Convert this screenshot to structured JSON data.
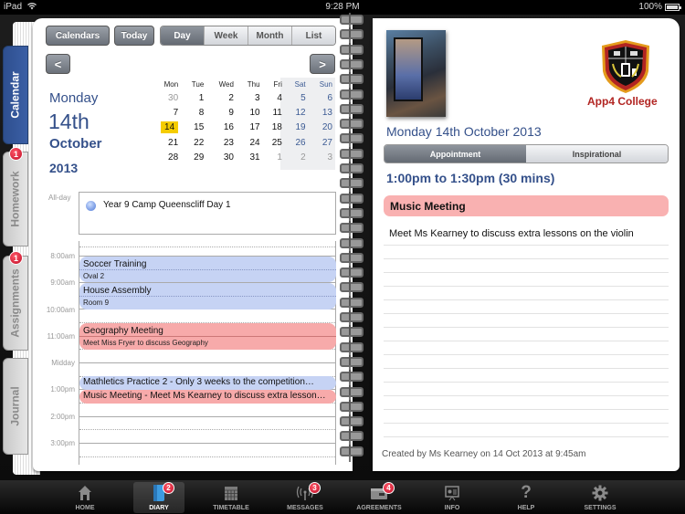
{
  "status_bar": {
    "device": "iPad",
    "time": "9:28 PM",
    "battery": "100%",
    "battery_level": 1.0
  },
  "side_tabs": [
    {
      "label": "Calendar",
      "active": true,
      "badge": null
    },
    {
      "label": "Homework",
      "active": false,
      "badge": "1"
    },
    {
      "label": "Assignments",
      "active": false,
      "badge": "1"
    },
    {
      "label": "Journal",
      "active": false,
      "badge": null
    }
  ],
  "toolbar": {
    "calendars_label": "Calendars",
    "today_label": "Today",
    "views": [
      "Day",
      "Week",
      "Month",
      "List"
    ],
    "active_view": "Day",
    "prev_label": "<",
    "next_label": ">"
  },
  "date_header": {
    "day_name": "Monday",
    "day": "14th",
    "month": "October",
    "year": "2013"
  },
  "mini_calendar": {
    "weekdays": [
      "Mon",
      "Tue",
      "Wed",
      "Thu",
      "Fri",
      "Sat",
      "Sun"
    ],
    "weeks": [
      [
        "30",
        "1",
        "2",
        "3",
        "4",
        "5",
        "6"
      ],
      [
        "7",
        "8",
        "9",
        "10",
        "11",
        "12",
        "13"
      ],
      [
        "14",
        "15",
        "16",
        "17",
        "18",
        "19",
        "20"
      ],
      [
        "21",
        "22",
        "23",
        "24",
        "25",
        "26",
        "27"
      ],
      [
        "28",
        "29",
        "30",
        "31",
        "1",
        "2",
        "3"
      ]
    ],
    "selected": "14"
  },
  "all_day": {
    "label": "All-day",
    "event": "Year 9 Camp Queenscliff Day 1",
    "event_color": "#4b76d6"
  },
  "time_labels": [
    "8:00am",
    "9:00am",
    "10:00am",
    "11:00am",
    "Midday",
    "1:00pm",
    "2:00pm",
    "3:00pm"
  ],
  "events": [
    {
      "title": "Soccer Training",
      "subtitle": "Oval 2",
      "color": "blue"
    },
    {
      "title": "House Assembly",
      "subtitle": "Room 9",
      "color": "blue"
    },
    {
      "title": "Geography Meeting",
      "subtitle": "Meet Miss Fryer to discuss Geography",
      "color": "red"
    },
    {
      "title": "Mathletics Practice 2 - Only 3 weeks to the competition…",
      "subtitle": null,
      "color": "blue"
    },
    {
      "title": "Music Meeting - Meet Ms Kearney to discuss extra lesson…",
      "subtitle": null,
      "color": "red"
    }
  ],
  "detail": {
    "logo_text": "App4 College",
    "date": "Monday 14th October 2013",
    "tabs": [
      "Appointment",
      "Inspirational"
    ],
    "active_tab": "Appointment",
    "time_range": "1:00pm to 1:30pm (30 mins)",
    "title": "Music Meeting",
    "description": "Meet Ms Kearney to discuss extra lessons on the violin",
    "created": "Created by Ms Kearney on 14 Oct 2013 at 9:45am"
  },
  "colors": {
    "accent_blue": "#34508a",
    "event_blue": "#c6d3f4",
    "event_red": "#f7aaaa",
    "today_highlight": "#f5cc00",
    "logo_red": "#b22522"
  },
  "tab_bar": [
    {
      "label": "HOME",
      "icon": "home-icon",
      "badge": null,
      "active": false
    },
    {
      "label": "DIARY",
      "icon": "diary-icon",
      "badge": "2",
      "active": true
    },
    {
      "label": "TIMETABLE",
      "icon": "timetable-icon",
      "badge": null,
      "active": false
    },
    {
      "label": "MESSAGES",
      "icon": "messages-icon",
      "badge": "3",
      "active": false
    },
    {
      "label": "AGREEMENTS",
      "icon": "agreements-icon",
      "badge": "4",
      "active": false
    },
    {
      "label": "INFO",
      "icon": "info-icon",
      "badge": null,
      "active": false
    },
    {
      "label": "HELP",
      "icon": "help-icon",
      "badge": null,
      "active": false
    },
    {
      "label": "SETTINGS",
      "icon": "settings-icon",
      "badge": null,
      "active": false
    }
  ]
}
